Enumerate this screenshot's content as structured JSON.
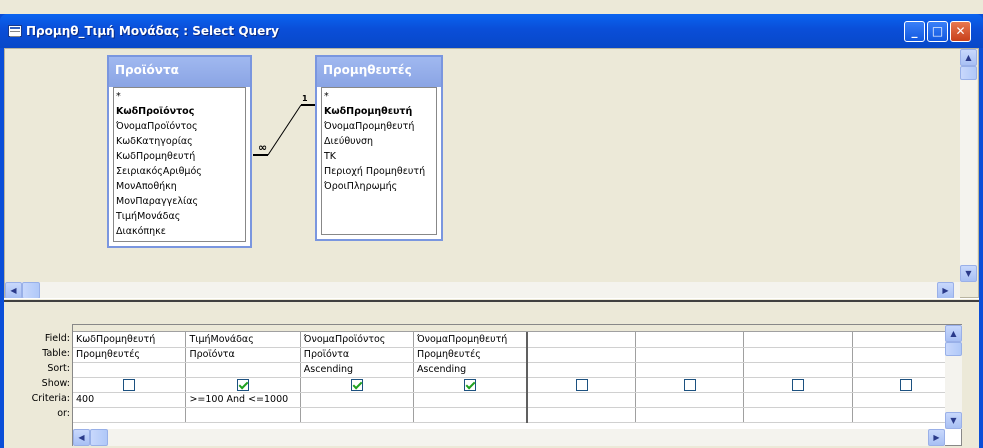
{
  "window": {
    "title": "Προμηθ_Τιμή Μονάδας : Select Query",
    "minimize_glyph": "_",
    "maximize_glyph": "□",
    "close_glyph": "✕"
  },
  "tables": [
    {
      "name": "Προϊόντα",
      "fields": [
        {
          "label": "*",
          "key": false
        },
        {
          "label": "ΚωδΠροϊόντος",
          "key": true
        },
        {
          "label": "ΌνομαΠροϊόντος",
          "key": false
        },
        {
          "label": "ΚωδΚατηγορίας",
          "key": false
        },
        {
          "label": "ΚωδΠρομηθευτή",
          "key": false
        },
        {
          "label": "ΣειριακόςΑριθμός",
          "key": false
        },
        {
          "label": "ΜονΑποθήκη",
          "key": false
        },
        {
          "label": "ΜονΠαραγγελίας",
          "key": false
        },
        {
          "label": "ΤιμήΜονάδας",
          "key": false
        },
        {
          "label": "Διακόπηκε",
          "key": false
        }
      ]
    },
    {
      "name": "Προμηθευτές",
      "fields": [
        {
          "label": "*",
          "key": false
        },
        {
          "label": "ΚωδΠρομηθευτή",
          "key": true
        },
        {
          "label": "ΌνομαΠρομηθευτή",
          "key": false
        },
        {
          "label": "Διεύθυνση",
          "key": false
        },
        {
          "label": "ΤΚ",
          "key": false
        },
        {
          "label": "Περιοχή Προμηθευτή",
          "key": false
        },
        {
          "label": "ΌροιΠληρωμής",
          "key": false
        }
      ]
    }
  ],
  "relationship": {
    "one_label": "1",
    "many_label": "∞"
  },
  "grid": {
    "row_labels": [
      "Field:",
      "Table:",
      "Sort:",
      "Show:",
      "Criteria:",
      "or:"
    ],
    "columns": [
      {
        "field": "ΚωδΠρομηθευτή",
        "table": "Προμηθευτές",
        "sort": "",
        "show": false,
        "criteria": "400",
        "or": ""
      },
      {
        "field": "ΤιμήΜονάδας",
        "table": "Προϊόντα",
        "sort": "",
        "show": true,
        "criteria": ">=100 And <=1000",
        "or": ""
      },
      {
        "field": "ΌνομαΠροϊόντος",
        "table": "Προϊόντα",
        "sort": "Ascending",
        "show": true,
        "criteria": "",
        "or": ""
      },
      {
        "field": "ΌνομαΠρομηθευτή",
        "table": "Προμηθευτές",
        "sort": "Ascending",
        "show": true,
        "criteria": "",
        "or": ""
      },
      {
        "field": "",
        "table": "",
        "sort": "",
        "show": false,
        "criteria": "",
        "or": ""
      },
      {
        "field": "",
        "table": "",
        "sort": "",
        "show": false,
        "criteria": "",
        "or": ""
      },
      {
        "field": "",
        "table": "",
        "sort": "",
        "show": false,
        "criteria": "",
        "or": ""
      },
      {
        "field": "",
        "table": "",
        "sort": "",
        "show": false,
        "criteria": "",
        "or": ""
      }
    ]
  },
  "colors": {
    "titlebar": "#0a4ed8",
    "table_header": "#8aa4e4",
    "checkmark": "#21a121",
    "background": "#ece9d8"
  }
}
